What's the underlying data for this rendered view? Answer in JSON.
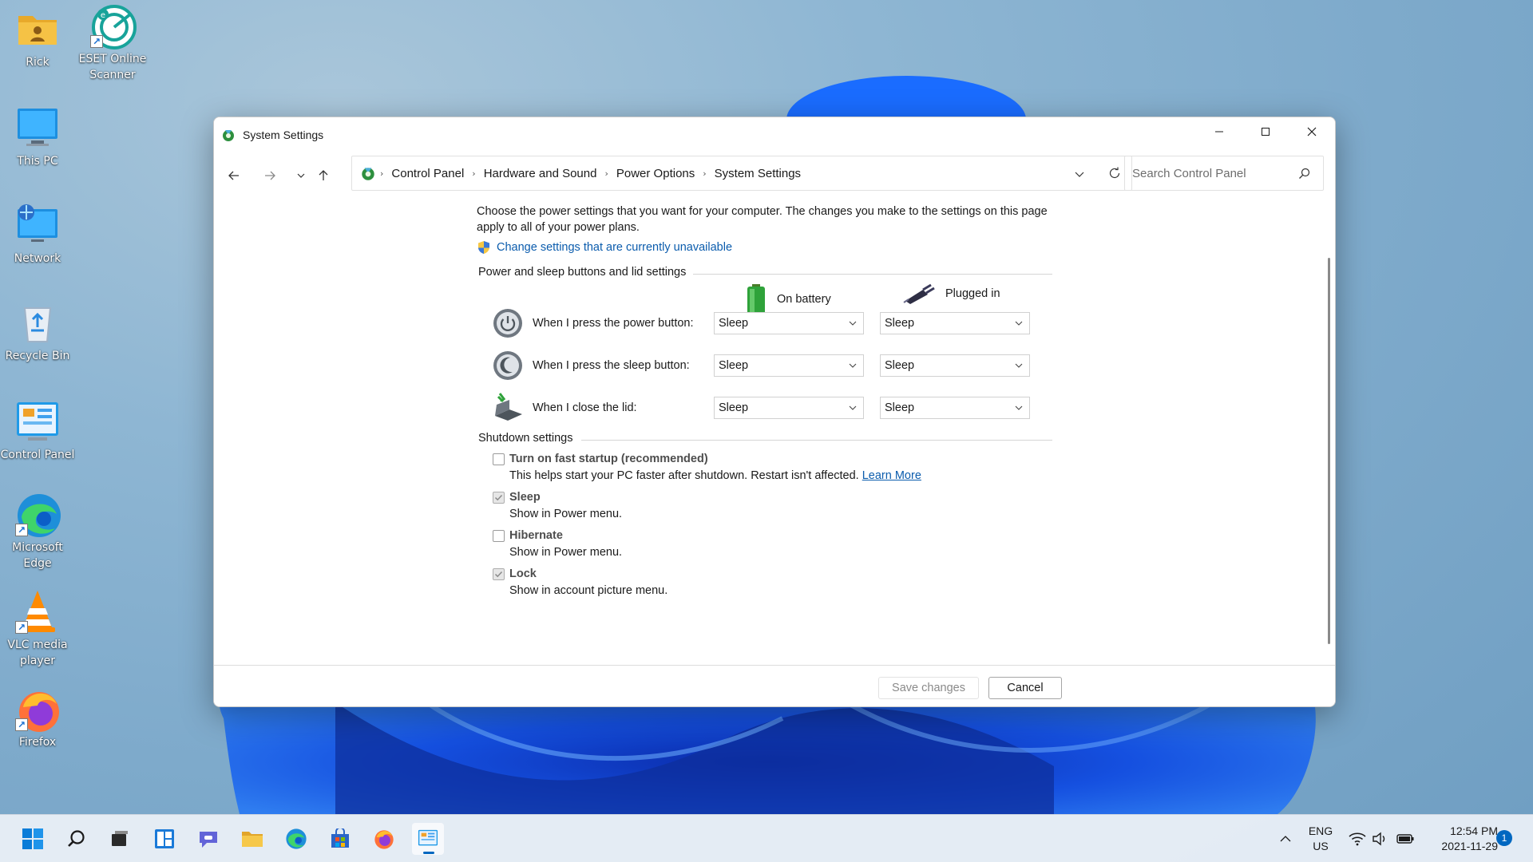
{
  "desktop": {
    "icons": [
      {
        "label": "Rick",
        "icon": "user-folder-icon"
      },
      {
        "label": "ESET Online Scanner",
        "icon": "eset-scanner-icon"
      },
      {
        "label": "This PC",
        "icon": "monitor-icon"
      },
      {
        "label": "Network",
        "icon": "network-icon"
      },
      {
        "label": "Recycle Bin",
        "icon": "recycle-bin-icon"
      },
      {
        "label": "Control Panel",
        "icon": "control-panel-icon"
      },
      {
        "label": "Microsoft Edge",
        "icon": "edge-icon"
      },
      {
        "label": "VLC media player",
        "icon": "vlc-icon"
      },
      {
        "label": "Firefox",
        "icon": "firefox-icon"
      }
    ]
  },
  "window": {
    "title": "System Settings",
    "breadcrumbs": [
      "Control Panel",
      "Hardware and Sound",
      "Power Options",
      "System Settings"
    ],
    "search_placeholder": "Search Control Panel"
  },
  "content": {
    "intro": "Choose the power settings that you want for your computer. The changes you make to the settings on this page apply to all of your power plans.",
    "change_link": "Change settings that are currently unavailable",
    "power_section_title": "Power and sleep buttons and lid settings",
    "col_battery": "On battery",
    "col_plugged": "Plugged in",
    "rows": [
      {
        "label": "When I press the power button:",
        "battery": "Sleep",
        "plugged": "Sleep"
      },
      {
        "label": "When I press the sleep button:",
        "battery": "Sleep",
        "plugged": "Sleep"
      },
      {
        "label": "When I close the lid:",
        "battery": "Sleep",
        "plugged": "Sleep"
      }
    ],
    "shutdown_section_title": "Shutdown settings",
    "shutdown": [
      {
        "title": "Turn on fast startup (recommended)",
        "desc": "This helps start your PC faster after shutdown. Restart isn't affected.",
        "link": "Learn More",
        "checked": false
      },
      {
        "title": "Sleep",
        "desc": "Show in Power menu.",
        "checked": true
      },
      {
        "title": "Hibernate",
        "desc": "Show in Power menu.",
        "checked": false
      },
      {
        "title": "Lock",
        "desc": "Show in account picture menu.",
        "checked": true
      }
    ]
  },
  "footer": {
    "save_label": "Save changes",
    "cancel_label": "Cancel"
  },
  "taskbar": {
    "lang_top": "ENG",
    "lang_bottom": "US",
    "time": "12:54 PM",
    "date": "2021-11-29",
    "notification_count": "1"
  },
  "colors": {
    "accent": "#0067c0",
    "link": "#0b5cad"
  }
}
